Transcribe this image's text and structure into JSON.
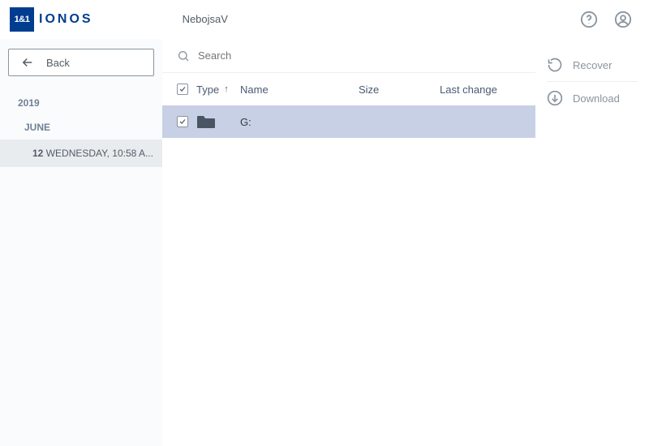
{
  "header": {
    "brand_badge": "1&1",
    "brand_text": "IONOS",
    "title": "NebojsaV"
  },
  "sidebar": {
    "back_label": "Back",
    "tree": {
      "year": "2019",
      "month": "JUNE",
      "item_day": "12",
      "item_rest": " WEDNESDAY, 10:58 A..."
    }
  },
  "search": {
    "placeholder": "Search"
  },
  "table": {
    "columns": {
      "type": "Type",
      "name": "Name",
      "size": "Size",
      "last_change": "Last change"
    },
    "rows": [
      {
        "name": "G:",
        "type": "folder",
        "size": "",
        "last_change": "",
        "checked": true
      }
    ]
  },
  "actions": {
    "recover": "Recover",
    "download": "Download"
  }
}
